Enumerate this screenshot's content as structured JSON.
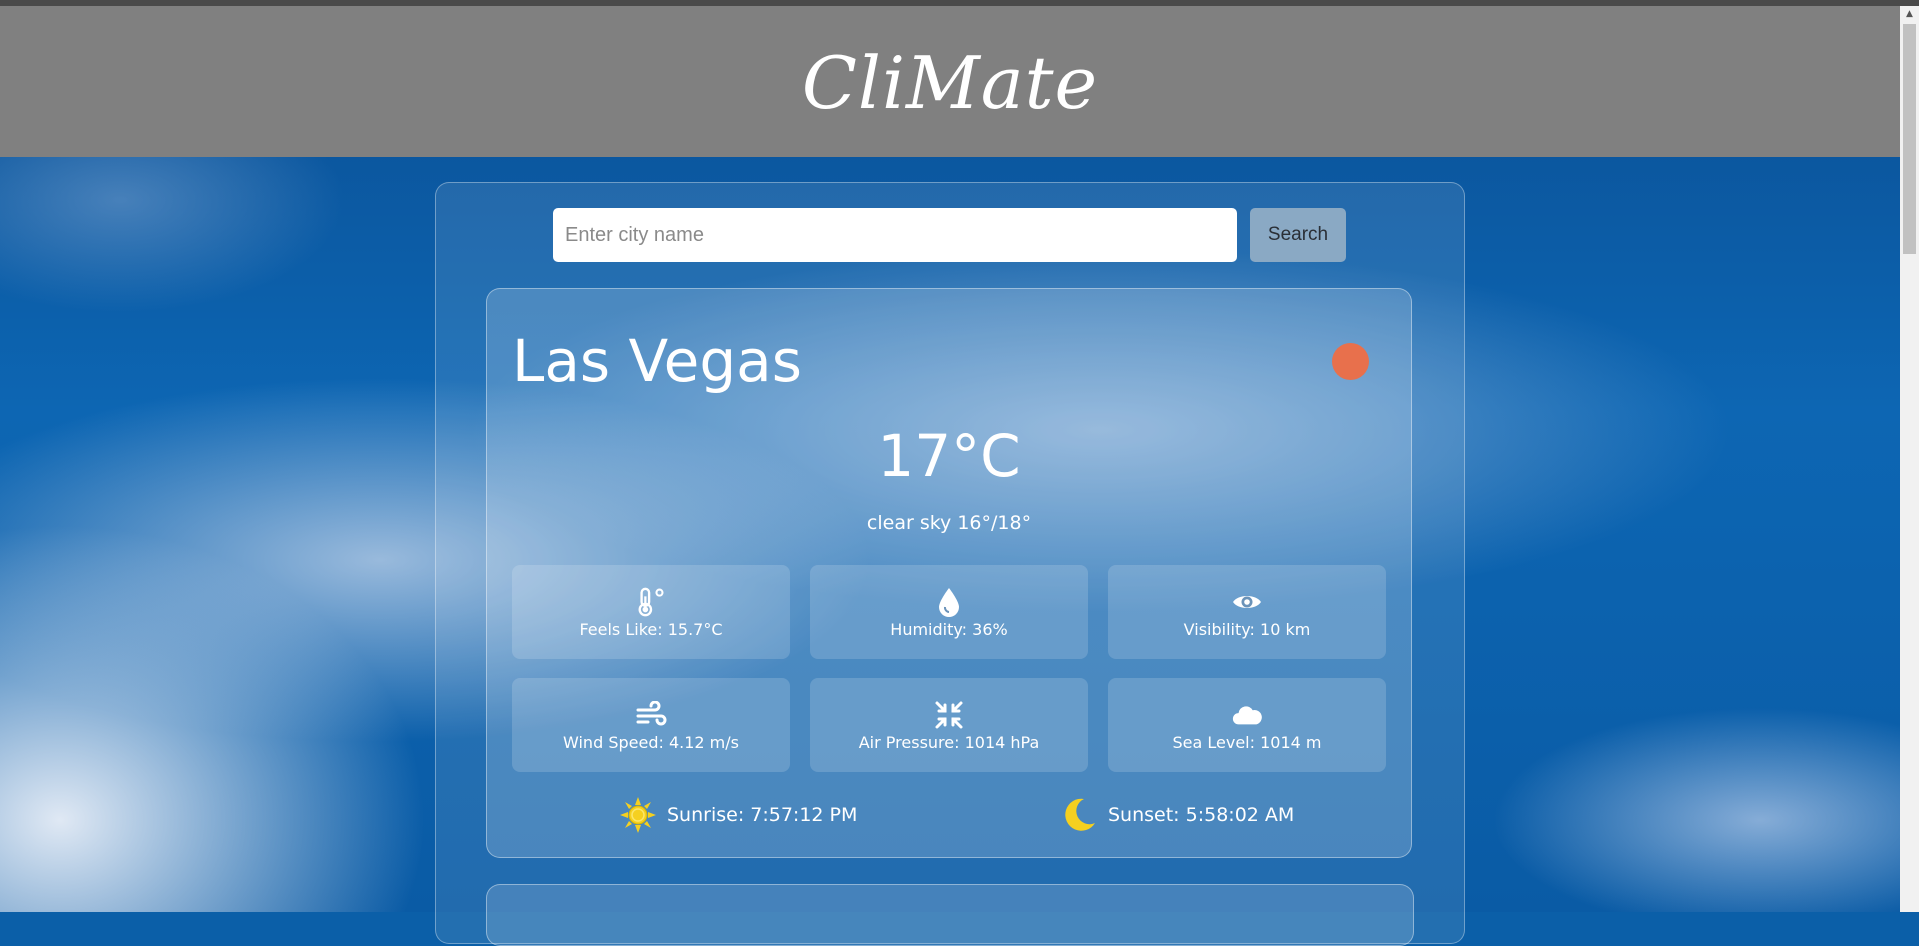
{
  "app": {
    "title": "CliMate"
  },
  "search": {
    "placeholder": "Enter city name",
    "value": "",
    "button_label": "Search"
  },
  "weather": {
    "city": "Las Vegas",
    "temperature": "17°C",
    "description": "clear sky 16°/18°",
    "status_color": "#e8704c",
    "details": [
      {
        "icon": "thermometer-icon",
        "label": "Feels Like: 15.7°C"
      },
      {
        "icon": "water-drop-icon",
        "label": "Humidity: 36%"
      },
      {
        "icon": "eye-icon",
        "label": "Visibility: 10 km"
      },
      {
        "icon": "wind-icon",
        "label": "Wind Speed: 4.12 m/s"
      },
      {
        "icon": "compress-icon",
        "label": "Air Pressure: 1014 hPa"
      },
      {
        "icon": "cloud-icon",
        "label": "Sea Level: 1014 m"
      }
    ],
    "sunrise": {
      "icon": "sun-icon",
      "label": "Sunrise: 7:57:12 PM"
    },
    "sunset": {
      "icon": "moon-icon",
      "label": "Sunset: 5:58:02 AM"
    }
  },
  "colors": {
    "header_bg": "#808080",
    "sun_yellow": "#f5d020",
    "search_button_bg": "#8aa9c4"
  }
}
